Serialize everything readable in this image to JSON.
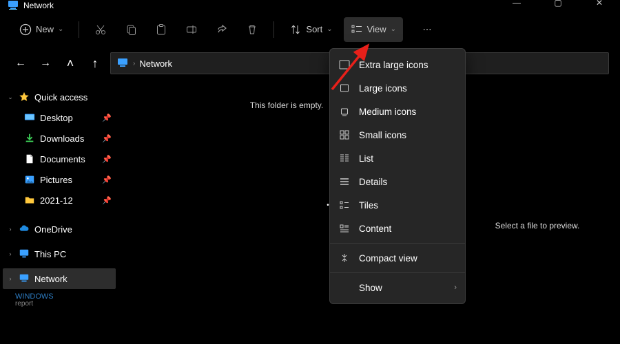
{
  "title": "Network",
  "toolbar": {
    "new": "New",
    "sort": "Sort",
    "view": "View"
  },
  "breadcrumb": {
    "current": "Network"
  },
  "sidebar": {
    "quick_access": "Quick access",
    "desktop": "Desktop",
    "downloads": "Downloads",
    "documents": "Documents",
    "pictures": "Pictures",
    "folder_date": "2021-12",
    "onedrive": "OneDrive",
    "this_pc": "This PC",
    "network": "Network"
  },
  "content": {
    "empty_text": "This folder is empty.",
    "preview_hint": "Select a file to preview."
  },
  "view_menu": {
    "xl_icons": "Extra large icons",
    "large_icons": "Large icons",
    "medium_icons": "Medium icons",
    "small_icons": "Small icons",
    "list": "List",
    "details": "Details",
    "tiles": "Tiles",
    "content": "Content",
    "compact": "Compact view",
    "show": "Show"
  },
  "watermark": {
    "line1": "WINDOWS",
    "line2": "report"
  }
}
